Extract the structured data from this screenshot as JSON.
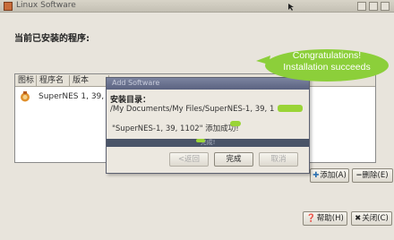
{
  "window": {
    "title": "Linux Software"
  },
  "heading": "当前已安装的程序:",
  "list": {
    "columns": [
      "图标",
      "程序名",
      "版本"
    ],
    "rows": [
      {
        "name": "SuperNES",
        "version": "1, 39, 110"
      }
    ]
  },
  "buttons": {
    "add": "添加(A)",
    "remove": "删除(E)",
    "help": "帮助(H)",
    "close": "关闭(C)"
  },
  "dialog": {
    "title": "Add Software",
    "install_dir_label": "安装目录：",
    "install_path": "/My Documents/My Files/SuperNES-1, 39, 1",
    "message": "\"SuperNES-1, 39, 1102\"  添加成功!",
    "progress_text": "完成!",
    "progress": 1.0,
    "buttons": {
      "back": "<返回",
      "finish": "完成",
      "cancel": "取消"
    }
  },
  "callout": {
    "line1": "Congratulations!",
    "line2": "Installation succeeds",
    "color": "#8ccf3a"
  },
  "colors": {
    "window_bg": "#e8e4dc",
    "dialog_title": "#5a6280",
    "progress": "#39414f"
  }
}
